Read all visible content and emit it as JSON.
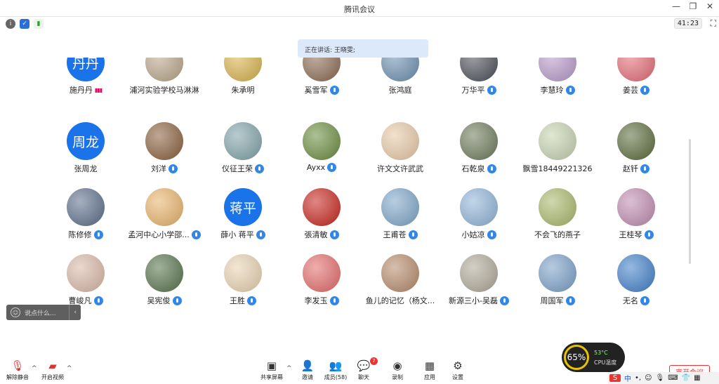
{
  "window": {
    "title": "腾讯会议",
    "controls": [
      "—",
      "❐",
      "✕"
    ]
  },
  "topbar": {
    "timer": "41:23",
    "icons": [
      "info-icon",
      "shield-icon",
      "signal-icon"
    ]
  },
  "speaking": {
    "text": "正在讲话: 王晓雯;"
  },
  "participants": [
    {
      "name": "施丹丹",
      "avatar_text": "丹丹",
      "color": "#1a73e8",
      "mic": "signal"
    },
    {
      "name": "浦河实验学校马淋淋",
      "avatar_text": "",
      "color": "#b9a58a",
      "mic": "none"
    },
    {
      "name": "朱承明",
      "avatar_text": "",
      "color": "#d8b24a",
      "mic": "none"
    },
    {
      "name": "奚雪军",
      "avatar_text": "",
      "color": "#8b6a52",
      "mic": "on"
    },
    {
      "name": "张鸿庭",
      "avatar_text": "",
      "color": "#6b8fb0",
      "mic": "none"
    },
    {
      "name": "万华平",
      "avatar_text": "",
      "color": "#4a4f57",
      "mic": "on"
    },
    {
      "name": "李慧玲",
      "avatar_text": "",
      "color": "#b79ac8",
      "mic": "on"
    },
    {
      "name": "姜芸",
      "avatar_text": "",
      "color": "#e46b75",
      "mic": "on"
    },
    {
      "name": "张周龙",
      "avatar_text": "周龙",
      "color": "#1a73e8",
      "mic": "none"
    },
    {
      "name": "刘洋",
      "avatar_text": "",
      "color": "#8a5f3c",
      "mic": "on"
    },
    {
      "name": "仪征王荣",
      "avatar_text": "",
      "color": "#7fa2a8",
      "mic": "on"
    },
    {
      "name": "Ayxx",
      "avatar_text": "",
      "color": "#6a8c3e",
      "mic": "on"
    },
    {
      "name": "许文文许武武",
      "avatar_text": "",
      "color": "#e8c9a6",
      "mic": "none"
    },
    {
      "name": "石乾泉",
      "avatar_text": "",
      "color": "#6d7a5a",
      "mic": "on"
    },
    {
      "name": "飘雪18449221326",
      "avatar_text": "",
      "color": "#c6d3b0",
      "mic": "none"
    },
    {
      "name": "赵钎",
      "avatar_text": "",
      "color": "#5a6b3a",
      "mic": "on"
    },
    {
      "name": "陈修修",
      "avatar_text": "",
      "color": "#5c6e8a",
      "mic": "on"
    },
    {
      "name": "孟河中心小学邵...",
      "avatar_text": "",
      "color": "#e9b36a",
      "mic": "on"
    },
    {
      "name": "薛小 蒋平",
      "avatar_text": "蒋平",
      "color": "#1a73e8",
      "mic": "on"
    },
    {
      "name": "張清敏",
      "avatar_text": "",
      "color": "#c7241d",
      "mic": "on"
    },
    {
      "name": "王甫苍",
      "avatar_text": "",
      "color": "#7da6c9",
      "mic": "on"
    },
    {
      "name": "小姑凉",
      "avatar_text": "",
      "color": "#8fb4d8",
      "mic": "on"
    },
    {
      "name": "不会飞的燕子",
      "avatar_text": "",
      "color": "#a9b86a",
      "mic": "none"
    },
    {
      "name": "王桂琴",
      "avatar_text": "",
      "color": "#c08bb0",
      "mic": "on"
    },
    {
      "name": "曹峻凡",
      "avatar_text": "",
      "color": "#d9b8a6",
      "mic": "on"
    },
    {
      "name": "吴宪俊",
      "avatar_text": "",
      "color": "#55724a",
      "mic": "on"
    },
    {
      "name": "王胜",
      "avatar_text": "",
      "color": "#e8d2b0",
      "mic": "on"
    },
    {
      "name": "李发玉",
      "avatar_text": "",
      "color": "#e46a6a",
      "mic": "on"
    },
    {
      "name": "鱼儿的记忆（杨文...",
      "avatar_text": "",
      "color": "#b68a6a",
      "mic": "none"
    },
    {
      "name": "新源三小-吴磊",
      "avatar_text": "",
      "color": "#b0a898",
      "mic": "on"
    },
    {
      "name": "周国军",
      "avatar_text": "",
      "color": "#7aa0c8",
      "mic": "on"
    },
    {
      "name": "无名",
      "avatar_text": "",
      "color": "#3f7fc8",
      "mic": "on"
    }
  ],
  "chat": {
    "placeholder": "说点什么..."
  },
  "bottom": {
    "mute": "解除静音",
    "video": "开启视频",
    "share": "共享屏幕",
    "invite": "邀请",
    "members": "成员(58)",
    "chat": "聊天",
    "chat_badge": "7",
    "record": "录制",
    "apps": "应用",
    "settings": "设置",
    "leave": "离开会议"
  },
  "cpu": {
    "percent": "65%",
    "temp": "53°C",
    "label": "CPU温度"
  },
  "tray": {
    "ime": "中"
  }
}
